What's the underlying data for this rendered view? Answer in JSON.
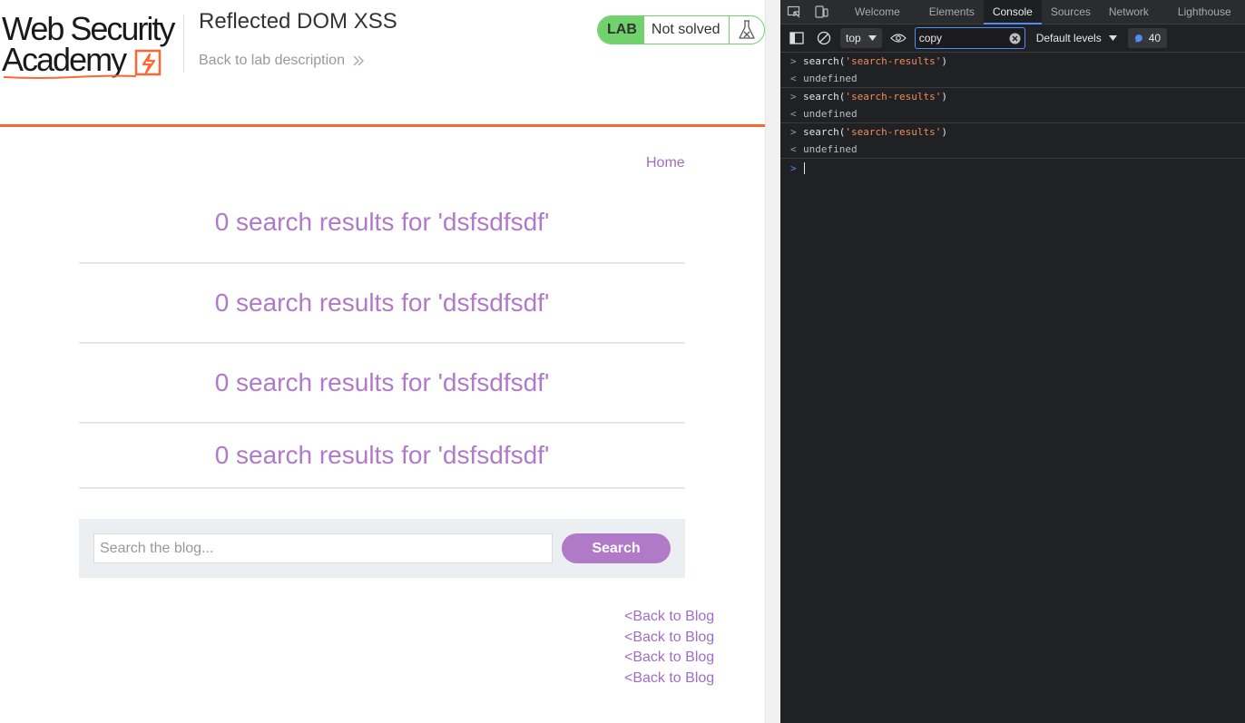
{
  "header": {
    "logo_line1": "Web Security",
    "logo_line2": "Academy",
    "lab_title": "Reflected DOM XSS",
    "back_link": "Back to lab description",
    "lab_badge": "LAB",
    "lab_status": "Not solved",
    "colors": {
      "lab_green": "#70d16d",
      "accent_orange": "#ff6633",
      "link_purple": "#9f6ec3"
    }
  },
  "nav": {
    "home": "Home"
  },
  "results": [
    "0 search results for 'dsfsdfsdf'",
    "0 search results for 'dsfsdfsdf'",
    "0 search results for 'dsfsdfsdf'",
    "0 search results for 'dsfsdfsdf'"
  ],
  "search": {
    "placeholder": "Search the blog...",
    "value": "",
    "button": "Search"
  },
  "back_links": [
    "<Back to Blog",
    "<Back to Blog",
    "<Back to Blog",
    "<Back to Blog"
  ],
  "devtools": {
    "tabs": [
      "Welcome",
      "Elements",
      "Console",
      "Sources",
      "Network",
      "Lighthouse"
    ],
    "active_tab": "Console",
    "context": "top",
    "filter_value": "copy",
    "levels": "Default levels",
    "message_count": "40",
    "console": [
      {
        "fn": "search(",
        "arg": "'search-results'",
        "close": ")",
        "result": "undefined"
      },
      {
        "fn": "search(",
        "arg": "'search-results'",
        "close": ")",
        "result": "undefined"
      },
      {
        "fn": "search(",
        "arg": "'search-results'",
        "close": ")",
        "result": "undefined"
      }
    ]
  }
}
